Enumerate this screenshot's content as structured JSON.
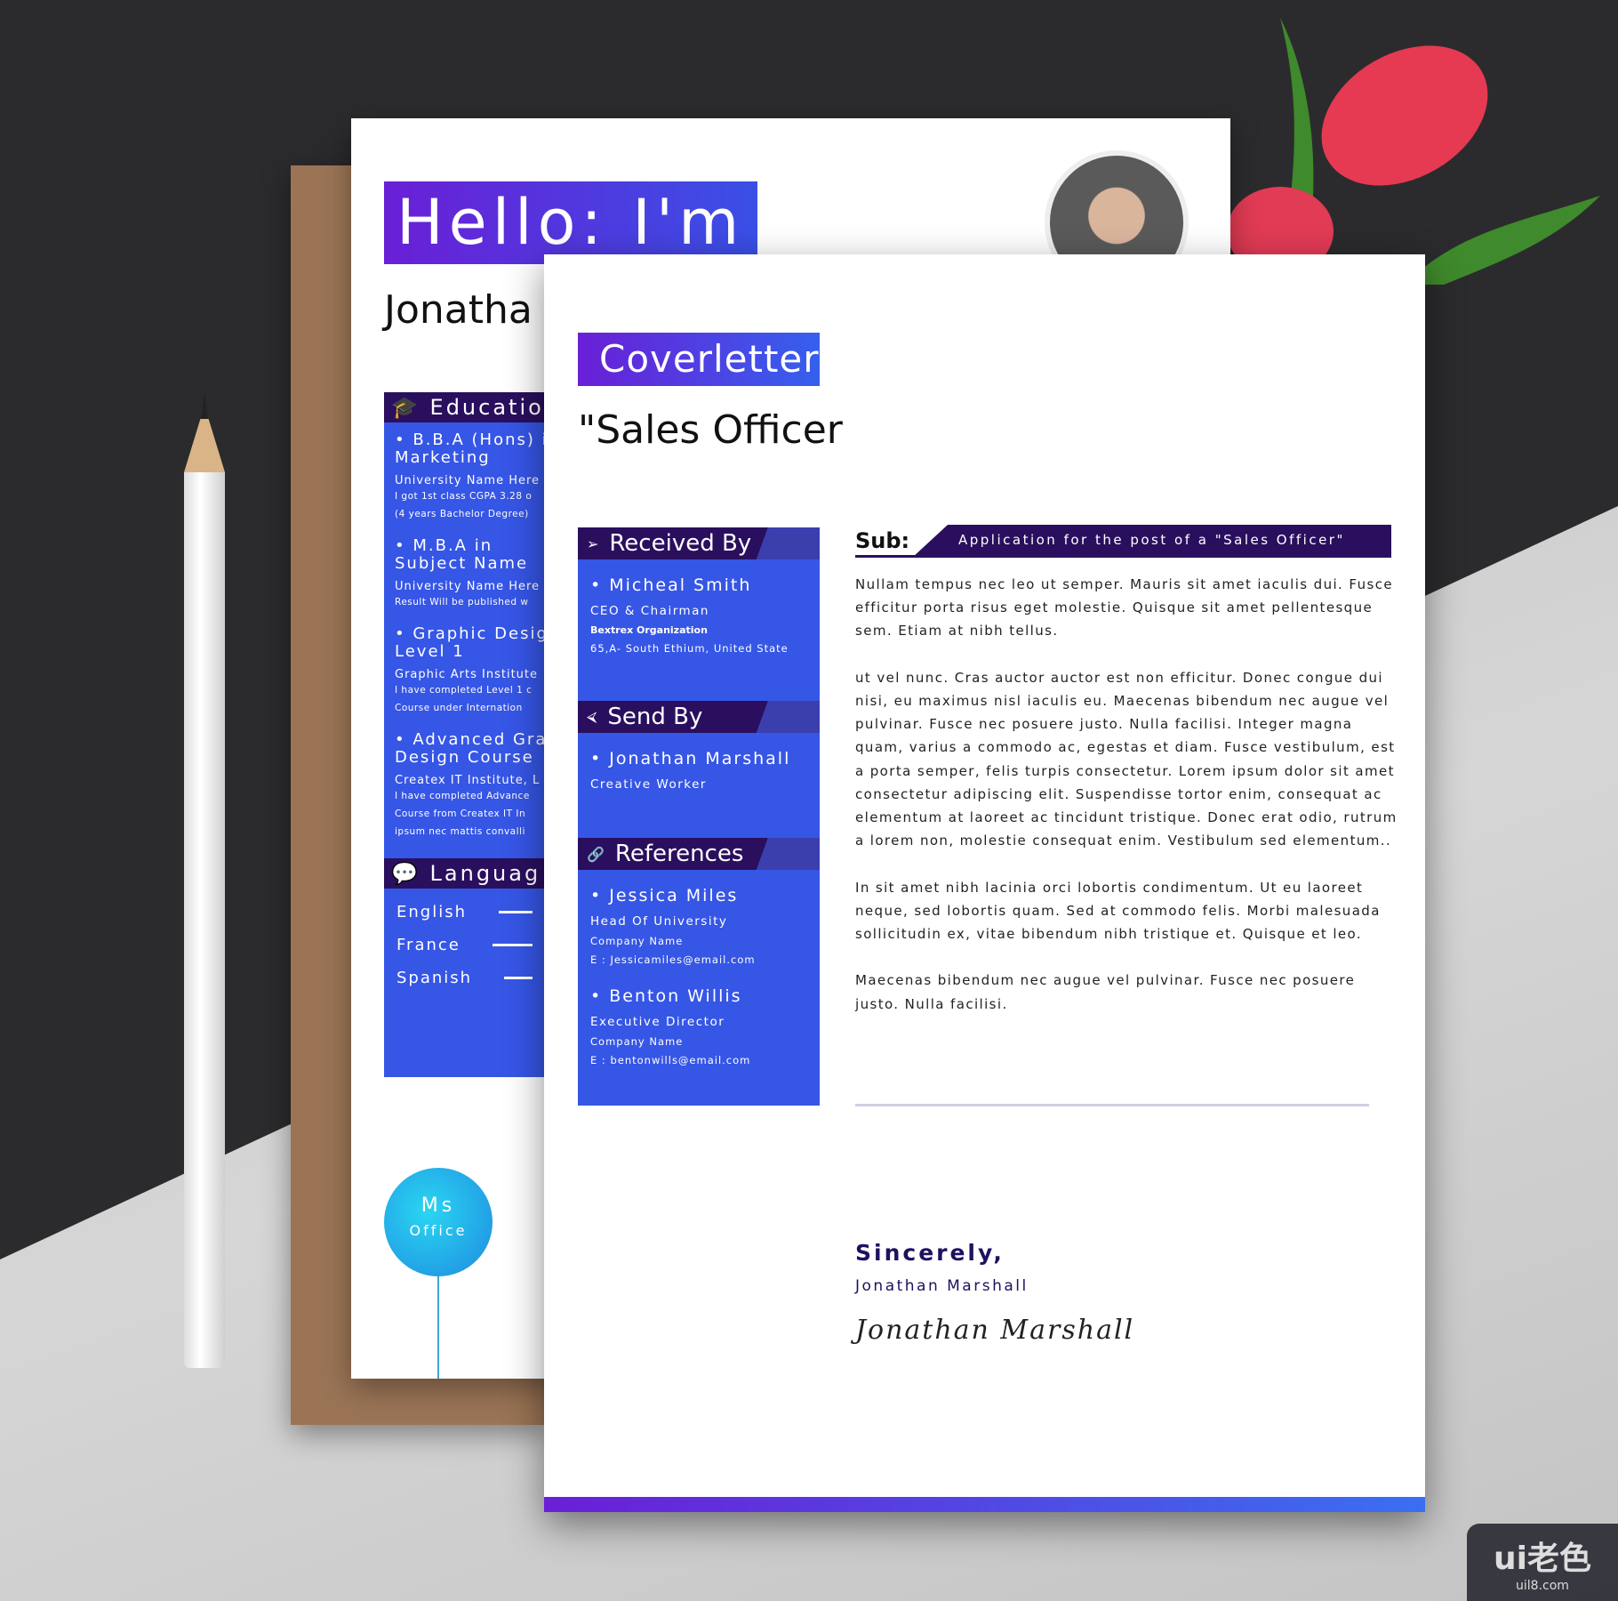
{
  "resume": {
    "hello": "Hello: I'm",
    "name": "Jonatha",
    "education": {
      "heading": "Educatio",
      "items": [
        {
          "title": "• B.B.A (Hons) in",
          "title2": "Marketing",
          "school": "University Name Here",
          "d1": "I got 1st class CGPA 3.28 o",
          "d2": "(4 years Bachelor Degree)"
        },
        {
          "title": "• M.B.A in",
          "title2": "Subject Name",
          "school": "University Name Here",
          "d1": "Result Will be published w",
          "d2": ""
        },
        {
          "title": "• Graphic Desig",
          "title2": "Level 1",
          "school": "Graphic Arts Institute",
          "d1": "I have completed Level 1 c",
          "d2": "Course under Internation"
        },
        {
          "title": "• Advanced Grap",
          "title2": "Design Course",
          "school": "Createx IT Institute, L",
          "d1": "I have completed Advance",
          "d2": "Course from Createx IT In",
          "d3": "ipsum nec mattis convalli"
        }
      ]
    },
    "languages": {
      "heading": "Languag",
      "items": [
        "English",
        "France",
        "Spanish"
      ]
    },
    "skill": {
      "line1": "Ms",
      "line2": "Office"
    }
  },
  "cover": {
    "banner": "Coverletter",
    "title": "\"Sales Officer",
    "received": {
      "heading": "Received By",
      "name": "• Micheal Smith",
      "role": "CEO & Chairman",
      "org": "Bextrex Organization",
      "address": "65,A- South Ethium, United State"
    },
    "send": {
      "heading": "Send By",
      "name": "• Jonathan Marshall",
      "role": "Creative Worker"
    },
    "references": {
      "heading": "References",
      "items": [
        {
          "name": "• Jessica Miles",
          "role": "Head Of University",
          "company": "Company Name",
          "email": "E : Jessicamiles@email.com"
        },
        {
          "name": "• Benton Willis",
          "role": "Executive Director",
          "company": "Company Name",
          "email": "E : bentonwills@email.com"
        }
      ]
    },
    "sub_label": "Sub:",
    "subject": "Application for the post of a \"Sales Officer\"",
    "paragraphs": [
      "Nullam tempus nec leo ut semper. Mauris sit amet iaculis dui. Fusce efficitur porta risus eget molestie. Quisque sit amet pellentesque sem. Etiam at nibh tellus.",
      "ut vel nunc. Cras auctor auctor est non efficitur. Donec congue dui nisi, eu maximus nisl iaculis eu. Maecenas bibendum nec augue vel pulvinar. Fusce nec posuere justo. Nulla facilisi. Integer magna quam, varius a commodo ac, egestas et diam. Fusce vestibulum, est a porta semper, felis turpis consectetur. Lorem ipsum dolor sit amet consectetur adipiscing elit. Suspendisse tortor enim, consequat ac elementum at laoreet ac  tincidunt tristique. Donec erat odio, rutrum a lorem non, molestie consequat enim. Vestibulum sed elementum..",
      "In sit amet nibh lacinia orci lobortis condimentum. Ut eu laoreet neque, sed lobortis quam. Sed at commodo felis. Morbi malesuada sollicitudin ex, vitae bibendum nibh tristique et. Quisque et leo.",
      " Maecenas bibendum nec augue vel pulvinar. Fusce nec posuere justo. Nulla facilisi."
    ],
    "closing": "Sincerely,",
    "closing_name": "Jonathan Marshall",
    "signature": "Jonathan Marshall"
  },
  "watermark": {
    "logo": "ui老色",
    "url": "uil8.com"
  },
  "colors": {
    "purple": "#6a1fd6",
    "navy": "#2a0f5e",
    "blue": "#3656e6",
    "cyan": "#2ad6f2"
  }
}
